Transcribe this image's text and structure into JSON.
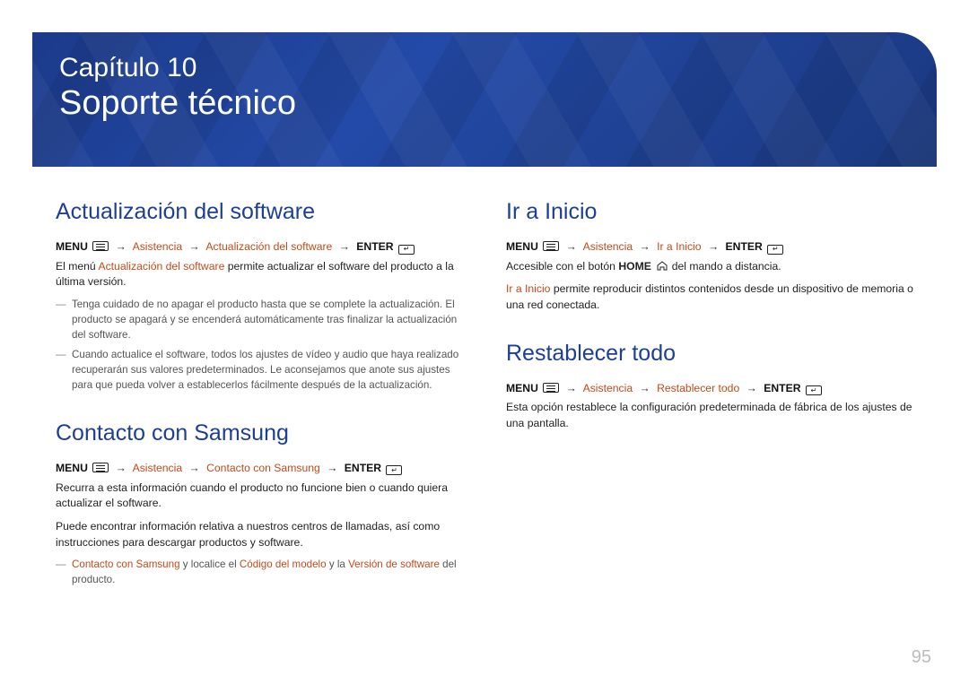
{
  "banner": {
    "chapter": "Capítulo 10",
    "title": "Soporte técnico"
  },
  "page_number": "95",
  "nav": {
    "arrow": "→"
  },
  "left": {
    "s1": {
      "heading": "Actualización del software",
      "path": {
        "menu": "MENU",
        "p1": "Asistencia",
        "p2": "Actualización del software",
        "enter": "ENTER"
      },
      "body_pre": "El menú ",
      "body_hl": "Actualización del software",
      "body_post": " permite actualizar el software del producto a la última versión.",
      "note1": "Tenga cuidado de no apagar el producto hasta que se complete la actualización. El producto se apagará y se encenderá automáticamente tras finalizar la actualización del software.",
      "note2": "Cuando actualice el software, todos los ajustes de vídeo y audio que haya realizado recuperarán sus valores predeterminados. Le aconsejamos que anote sus ajustes para que pueda volver a establecerlos fácilmente después de la actualización."
    },
    "s2": {
      "heading": "Contacto con Samsung",
      "path": {
        "menu": "MENU",
        "p1": "Asistencia",
        "p2": "Contacto con Samsung",
        "enter": "ENTER"
      },
      "body1": "Recurra a esta información cuando el producto no funcione bien o cuando quiera actualizar el software.",
      "body2": "Puede encontrar información relativa a nuestros centros de llamadas, así como instrucciones para descargar productos y software.",
      "note_hl1": "Contacto con Samsung",
      "note_mid1": " y localice el ",
      "note_hl2": "Código del modelo",
      "note_mid2": " y la ",
      "note_hl3": "Versión de software",
      "note_post": " del producto."
    }
  },
  "right": {
    "s1": {
      "heading": "Ir a Inicio",
      "path": {
        "menu": "MENU",
        "p1": "Asistencia",
        "p2": "Ir a Inicio",
        "enter": "ENTER"
      },
      "body1_pre": "Accesible con el botón ",
      "body1_b": "HOME",
      "body1_post": " del mando a distancia.",
      "body2_hl": "Ir a Inicio",
      "body2_post": " permite reproducir distintos contenidos desde un dispositivo de memoria o una red conectada."
    },
    "s2": {
      "heading": "Restablecer todo",
      "path": {
        "menu": "MENU",
        "p1": "Asistencia",
        "p2": "Restablecer todo",
        "enter": "ENTER"
      },
      "body": "Esta opción restablece la configuración predeterminada de fábrica de los ajustes de una pantalla."
    }
  }
}
